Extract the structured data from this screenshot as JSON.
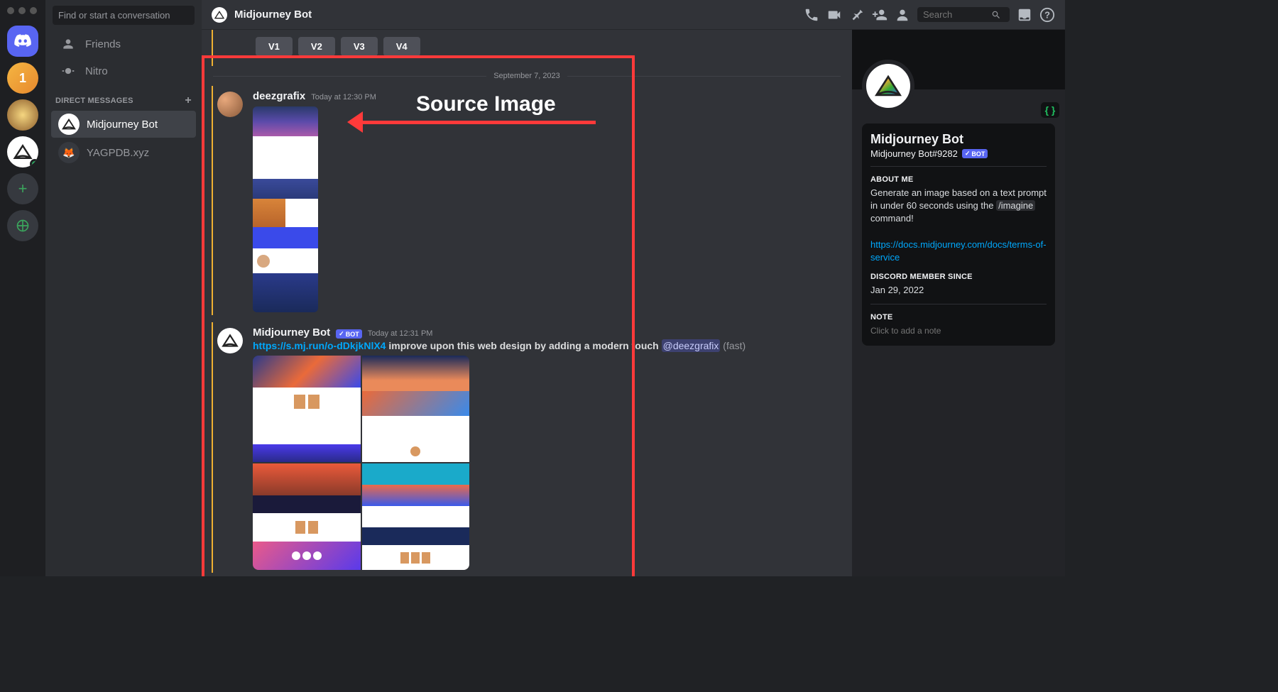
{
  "header": {
    "title": "Midjourney Bot",
    "search_placeholder": "Search"
  },
  "sidebar": {
    "search_placeholder": "Find or start a conversation",
    "friends": "Friends",
    "nitro": "Nitro",
    "dm_header": "DIRECT MESSAGES",
    "dm_items": [
      {
        "label": "Midjourney Bot"
      },
      {
        "label": "YAGPDB.xyz"
      }
    ]
  },
  "vbuttons": [
    "V1",
    "V2",
    "V3",
    "V4"
  ],
  "date_divider": "September 7, 2023",
  "msg1": {
    "user": "deezgrafix",
    "time": "Today at 12:30 PM"
  },
  "msg2": {
    "user": "Midjourney Bot",
    "bot_tag": "BOT",
    "time": "Today at 12:31 PM",
    "link": "https://s.mj.run/o-dDkjkNlX4",
    "prompt": " improve upon this web design by adding a modern touch ",
    "mention": "@deezgrafix",
    "suffix": " (fast)"
  },
  "annotation": {
    "label": "Source Image"
  },
  "profile": {
    "name": "Midjourney Bot",
    "discriminator": "Midjourney Bot#9282",
    "bot_tag": "BOT",
    "about_head": "ABOUT ME",
    "about_1": "Generate an image based on a text prompt in under 60 seconds using the ",
    "about_cmd": "/imagine",
    "about_2": " command!",
    "about_link": "https://docs.midjourney.com/docs/terms-of-service",
    "member_head": "DISCORD MEMBER SINCE",
    "member_date": "Jan 29, 2022",
    "note_head": "NOTE",
    "note_placeholder": "Click to add a note"
  }
}
